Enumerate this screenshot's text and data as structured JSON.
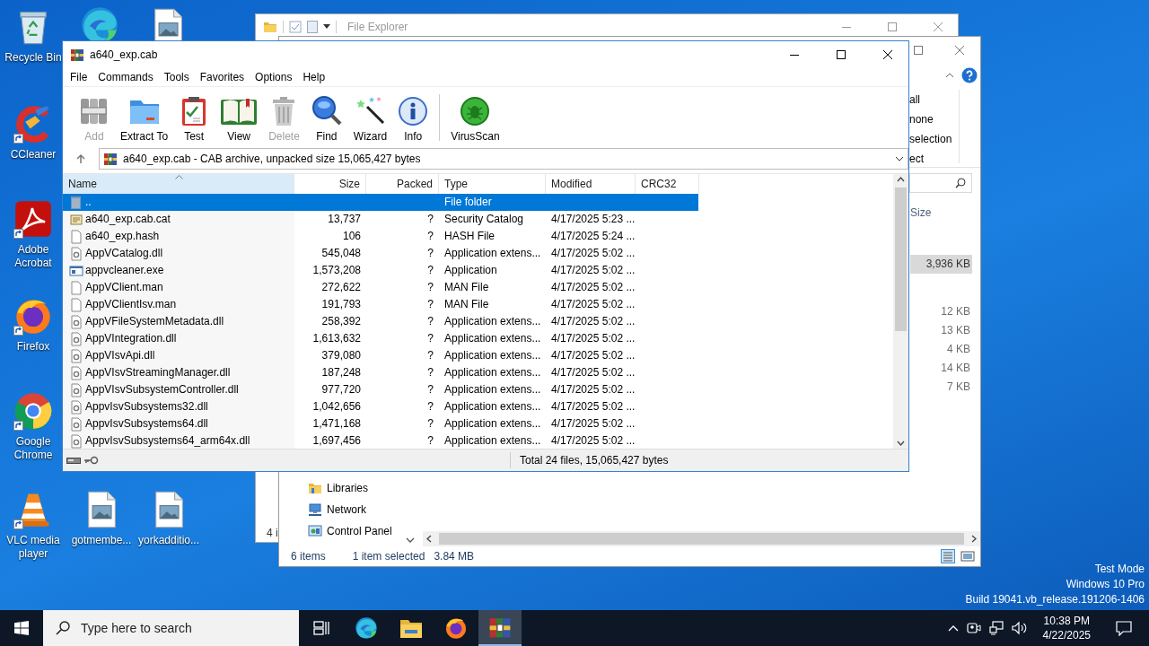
{
  "desktop_icons": [
    {
      "kind": "recycle",
      "shortcut": false,
      "label": "Recycle Bin"
    },
    {
      "kind": "edge",
      "shortcut": false
    },
    {
      "kind": "image",
      "shortcut": false
    },
    {
      "kind": "ccleaner",
      "shortcut": true,
      "label": "CCleaner"
    },
    {
      "kind": "acrobat",
      "shortcut": true,
      "label": "Adobe Acrobat"
    },
    {
      "kind": "firefox",
      "shortcut": true,
      "label": "Firefox"
    },
    {
      "kind": "chrome",
      "shortcut": true,
      "label": "Google Chrome"
    },
    {
      "kind": "vlc",
      "shortcut": true,
      "label": "VLC media player"
    },
    {
      "kind": "image",
      "shortcut": false,
      "label": "gotmembe..."
    },
    {
      "kind": "image",
      "shortcut": false,
      "label": "yorkadditio..."
    }
  ],
  "explorer_back": {
    "title": "File Explorer",
    "status": "4 i"
  },
  "explorer_front": {
    "ribbon_commands": [
      "all",
      "none",
      "selection",
      "ect"
    ],
    "column_header": "Size",
    "rows": [
      {
        "size": "3,936 KB",
        "selected": true
      },
      {
        "size": "12 KB",
        "selected": false
      },
      {
        "size": "13 KB",
        "selected": false
      },
      {
        "size": "4 KB",
        "selected": false
      },
      {
        "size": "14 KB",
        "selected": false
      },
      {
        "size": "7 KB",
        "selected": false
      }
    ],
    "nav_items": [
      {
        "kind": "libraries",
        "label": "Libraries"
      },
      {
        "kind": "network",
        "label": "Network"
      },
      {
        "kind": "control_panel",
        "label": "Control Panel"
      }
    ],
    "status_count": "6 items",
    "status_selection": "1 item selected",
    "status_size": "3.84 MB"
  },
  "winrar": {
    "title": "a640_exp.cab",
    "menu": [
      "File",
      "Commands",
      "Tools",
      "Favorites",
      "Options",
      "Help"
    ],
    "toolbar": [
      {
        "kind": "add",
        "label": "Add",
        "disabled": true
      },
      {
        "kind": "extract",
        "label": "Extract To",
        "disabled": false
      },
      {
        "kind": "test",
        "label": "Test",
        "disabled": false
      },
      {
        "kind": "view",
        "label": "View",
        "disabled": false
      },
      {
        "kind": "delete",
        "label": "Delete",
        "disabled": true
      },
      {
        "kind": "find",
        "label": "Find",
        "disabled": false
      },
      {
        "kind": "wizard",
        "label": "Wizard",
        "disabled": false
      },
      {
        "kind": "info",
        "label": "Info",
        "disabled": false
      },
      {
        "kind": "virusscan",
        "label": "VirusScan",
        "disabled": false
      }
    ],
    "path": "a640_exp.cab - CAB archive, unpacked size 15,065,427 bytes",
    "columns": [
      {
        "label": "Name",
        "sorted": true
      },
      {
        "label": "Size",
        "sorted": false
      },
      {
        "label": "Packed",
        "sorted": false
      },
      {
        "label": "Type",
        "sorted": false
      },
      {
        "label": "Modified",
        "sorted": false
      },
      {
        "label": "CRC32",
        "sorted": false
      }
    ],
    "files": [
      {
        "kind": "folder",
        "name": "..",
        "type": "File folder",
        "selected": true
      },
      {
        "kind": "catalog",
        "name": "a640_exp.cab.cat",
        "size": "13,737",
        "packed": "?",
        "type": "Security Catalog",
        "modified": "4/17/2025 5:23 ...",
        "selected": false
      },
      {
        "kind": "file",
        "name": "a640_exp.hash",
        "size": "106",
        "packed": "?",
        "type": "HASH File",
        "modified": "4/17/2025 5:24 ...",
        "selected": false
      },
      {
        "kind": "dll",
        "name": "AppVCatalog.dll",
        "size": "545,048",
        "packed": "?",
        "type": "Application extens...",
        "modified": "4/17/2025 5:02 ...",
        "selected": false
      },
      {
        "kind": "exe",
        "name": "appvcleaner.exe",
        "size": "1,573,208",
        "packed": "?",
        "type": "Application",
        "modified": "4/17/2025 5:02 ...",
        "selected": false
      },
      {
        "kind": "file",
        "name": "AppVClient.man",
        "size": "272,622",
        "packed": "?",
        "type": "MAN File",
        "modified": "4/17/2025 5:02 ...",
        "selected": false
      },
      {
        "kind": "file",
        "name": "AppVClientIsv.man",
        "size": "191,793",
        "packed": "?",
        "type": "MAN File",
        "modified": "4/17/2025 5:02 ...",
        "selected": false
      },
      {
        "kind": "dll",
        "name": "AppVFileSystemMetadata.dll",
        "size": "258,392",
        "packed": "?",
        "type": "Application extens...",
        "modified": "4/17/2025 5:02 ...",
        "selected": false
      },
      {
        "kind": "dll",
        "name": "AppVIntegration.dll",
        "size": "1,613,632",
        "packed": "?",
        "type": "Application extens...",
        "modified": "4/17/2025 5:02 ...",
        "selected": false
      },
      {
        "kind": "dll",
        "name": "AppVIsvApi.dll",
        "size": "379,080",
        "packed": "?",
        "type": "Application extens...",
        "modified": "4/17/2025 5:02 ...",
        "selected": false
      },
      {
        "kind": "dll",
        "name": "AppVIsvStreamingManager.dll",
        "size": "187,248",
        "packed": "?",
        "type": "Application extens...",
        "modified": "4/17/2025 5:02 ...",
        "selected": false
      },
      {
        "kind": "dll",
        "name": "AppVIsvSubsystemController.dll",
        "size": "977,720",
        "packed": "?",
        "type": "Application extens...",
        "modified": "4/17/2025 5:02 ...",
        "selected": false
      },
      {
        "kind": "dll",
        "name": "AppvIsvSubsystems32.dll",
        "size": "1,042,656",
        "packed": "?",
        "type": "Application extens...",
        "modified": "4/17/2025 5:02 ...",
        "selected": false
      },
      {
        "kind": "dll",
        "name": "AppvIsvSubsystems64.dll",
        "size": "1,471,168",
        "packed": "?",
        "type": "Application extens...",
        "modified": "4/17/2025 5:02 ...",
        "selected": false
      },
      {
        "kind": "dll",
        "name": "AppvIsvSubsystems64_arm64x.dll",
        "size": "1,697,456",
        "packed": "?",
        "type": "Application extens...",
        "modified": "4/17/2025 5:02 ...",
        "selected": false
      }
    ],
    "status": "Total 24 files, 15,065,427 bytes"
  },
  "taskbar": {
    "search_placeholder": "Type here to search",
    "apps": [
      {
        "kind": "taskview",
        "active": false
      },
      {
        "kind": "edge",
        "active": false
      },
      {
        "kind": "explorer",
        "active": false
      },
      {
        "kind": "firefox",
        "active": false
      },
      {
        "kind": "winrar",
        "active": true
      }
    ],
    "time": "10:38 PM",
    "date": "4/22/2025"
  },
  "system_notice": [
    "Test Mode",
    "Windows 10 Pro",
    "Build 19041.vb_release.191206-1406"
  ]
}
